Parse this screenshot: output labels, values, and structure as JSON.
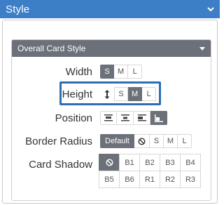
{
  "header": {
    "title": "Style"
  },
  "section": {
    "title": "Overall Card Style"
  },
  "rows": {
    "width": {
      "label": "Width",
      "options": [
        "S",
        "M",
        "L"
      ],
      "selected": "S"
    },
    "height": {
      "label": "Height",
      "options": [
        "↕",
        "S",
        "M",
        "L"
      ],
      "selected": "M"
    },
    "position": {
      "label": "Position",
      "options": [
        "align-top-icon",
        "align-middle-icon",
        "align-left-icon",
        "align-bottom-icon"
      ],
      "selected": "align-bottom-icon"
    },
    "border_radius": {
      "label": "Border Radius",
      "options": [
        "Default",
        "⊘",
        "S",
        "M",
        "L"
      ],
      "selected": "Default"
    },
    "card_shadow": {
      "label": "Card Shadow",
      "options": [
        "⊘",
        "B1",
        "B2",
        "B3",
        "B4",
        "B5",
        "B6",
        "R1",
        "R2",
        "R3"
      ],
      "selected": "⊘"
    }
  },
  "colors": {
    "accent": "#3d7fc6",
    "active": "#6b7079",
    "highlight": "#2b6fb6"
  }
}
